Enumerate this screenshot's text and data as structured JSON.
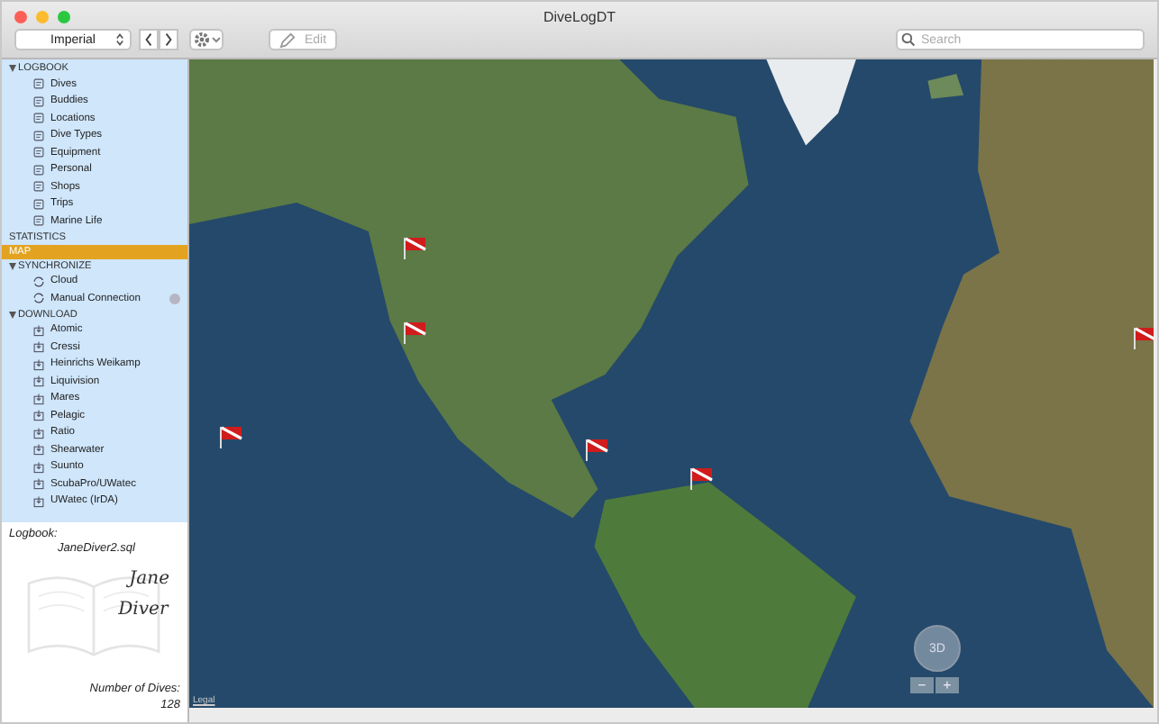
{
  "window": {
    "title": "DiveLogDT"
  },
  "toolbar": {
    "units_popup": "Imperial",
    "edit_button": {
      "label": "Edit",
      "disabled": true
    },
    "search": {
      "placeholder": "Search"
    }
  },
  "sidebar": {
    "sections": [
      {
        "kind": "group",
        "title": "LOGBOOK",
        "selected": false,
        "expanded": true,
        "items": [
          {
            "label": "Dives",
            "selected": false
          },
          {
            "label": "Buddies",
            "selected": false
          },
          {
            "label": "Locations",
            "selected": false
          },
          {
            "label": "Dive Types",
            "selected": false
          },
          {
            "label": "Equipment",
            "selected": false
          },
          {
            "label": "Personal",
            "selected": false
          },
          {
            "label": "Shops",
            "selected": false
          },
          {
            "label": "Trips",
            "selected": false
          },
          {
            "label": "Marine Life",
            "selected": false
          }
        ]
      },
      {
        "kind": "link",
        "title": "STATISTICS",
        "selected": false
      },
      {
        "kind": "link",
        "title": "MAP",
        "selected": true
      },
      {
        "kind": "group",
        "title": "SYNCHRONIZE",
        "selected": false,
        "expanded": true,
        "items": [
          {
            "label": "Cloud",
            "selected": false
          },
          {
            "label": "Manual Connection",
            "selected": false,
            "badge": true
          }
        ]
      },
      {
        "kind": "group",
        "title": "DOWNLOAD",
        "selected": false,
        "expanded": true,
        "items": [
          {
            "label": "Atomic",
            "selected": false
          },
          {
            "label": "Cressi",
            "selected": false
          },
          {
            "label": "Heinrichs Weikamp",
            "selected": false
          },
          {
            "label": "Liquivision",
            "selected": false
          },
          {
            "label": "Mares",
            "selected": false
          },
          {
            "label": "Pelagic",
            "selected": false
          },
          {
            "label": "Ratio",
            "selected": false
          },
          {
            "label": "Shearwater",
            "selected": false
          },
          {
            "label": "Suunto",
            "selected": false
          },
          {
            "label": "ScubaPro/UWatec",
            "selected": false
          },
          {
            "label": "UWatec (IrDA)",
            "selected": false
          }
        ]
      }
    ]
  },
  "logbook_panel": {
    "label": "Logbook:",
    "file": "JaneDiver2.sql",
    "signature": [
      "Jane",
      "Diver"
    ],
    "dives_label": "Number of Dives:",
    "dives_count": "128"
  },
  "map": {
    "compass_label": "3D",
    "zoom_out": "−",
    "zoom_in": "+",
    "legal": "Legal"
  }
}
